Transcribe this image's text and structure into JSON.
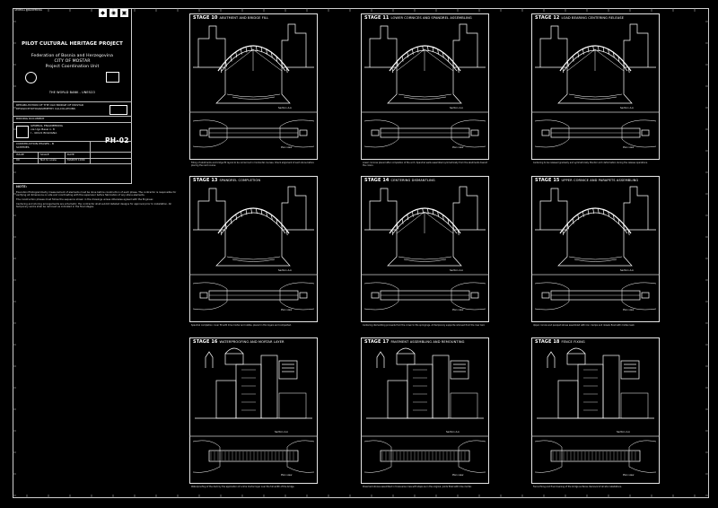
{
  "titleblock": {
    "header_small": "GENERAL ENGINEERING",
    "project": "PILOT CULTURAL HERITAGE PROJECT",
    "federation": "Federation of Bosnia and Herzegovina",
    "city": "CITY OF MOSTAR",
    "unit": "Project Coordination Unit",
    "funders": "THE WORLD BANK - UNESCO",
    "title_line1": "REHABILITATION OF THE OLD BRIDGE OF MOSTAR",
    "title_line2": "DESIGN PHOTOGRAMMETRY CALCULATIONS",
    "doc_type": "BIDDING DOCUMENT",
    "firm_line1": "GENERAL ENGINEERING",
    "firm_line2": "via Ugo Bassi n. 8",
    "firm_line3": "I - 40121 BOLOGNA",
    "drawing_title_1": "CONSTRUCTION PHASES - B",
    "drawing_title_2": "SCHEMES",
    "sheet_no": "PH-02",
    "row1_a": "ISSUE",
    "row1_b": "SCALE",
    "row1_c": "DATE",
    "row2_a": "00",
    "row2_b": "Not to scale",
    "row2_c": "MARCH 1999"
  },
  "notes": {
    "title": "NOTE:",
    "p1": "Execution Photogrammetry measurement of elements must be done before construction of each phase. The contractor is responsible for verifying all dimensions on site and coordinating with the supervisor before fabrication of any stone elements.",
    "p2": "The construction phases must follow the sequence shown in the drawings unless otherwise agreed with the Engineer.",
    "p3": "Centering and shoring arrangements are schematic; the contractor shall submit detailed designs for approval prior to installation. All temporary works shall be removed as indicated in the final stages."
  },
  "panels": [
    {
      "stage": "STAGE 10",
      "title": "ABUTMENT AND BRIDGE FILL",
      "caption": "Filling of abutments and bridge fill layers to be carried out in horizontal courses. Check alignment of each stone before placing the next course."
    },
    {
      "stage": "STAGE 11",
      "title": "LOWER CORNICES AND SPANDREL ASSEMBLING",
      "caption": "Lower cornices placed after completion of the arch. Spandrel walls assembled symmetrically from the abutments toward the crown."
    },
    {
      "stage": "STAGE 12",
      "title": "LOAD BEARING CENTERING RELEASE",
      "caption": "Centering to be released gradually and symmetrically. Monitor arch deformation during the release operations."
    },
    {
      "stage": "STAGE 13",
      "title": "SPANDREL COMPLETION",
      "caption": "Spandrel completion: inner fill with lime mortar and rubble, placed in thin layers and compacted."
    },
    {
      "stage": "STAGE 14",
      "title": "CENTERING DISMANTLING",
      "caption": "Centering dismantling proceeds from the crown to the springings. All temporary supports removed from the river bed."
    },
    {
      "stage": "STAGE 15",
      "title": "UPPER CORNICE AND PARAPETS ASSEMBLING",
      "caption": "Upper cornice and parapet stones assembled with iron cramps and dowels fixed with molten lead."
    },
    {
      "stage": "STAGE 16",
      "title": "WATERPROOFING AND MORTAR LAYER",
      "caption": "Waterproofing of the deck by the application of a lime mortar layer over the full width of the bridge."
    },
    {
      "stage": "STAGE 17",
      "title": "PAVEMENT ASSEMBLING AND REMOUNTING",
      "caption": "Pavement stones assembled in transverse rows with steps as in the original. Joints filled with lime mortar."
    },
    {
      "stage": "STAGE 18",
      "title": "FENCE FIXING",
      "caption": "Fence fixing and final cleaning of the bridge surfaces. Removal of all site installations."
    }
  ],
  "labels": {
    "section": "Section A-A",
    "plan": "Plan view"
  }
}
